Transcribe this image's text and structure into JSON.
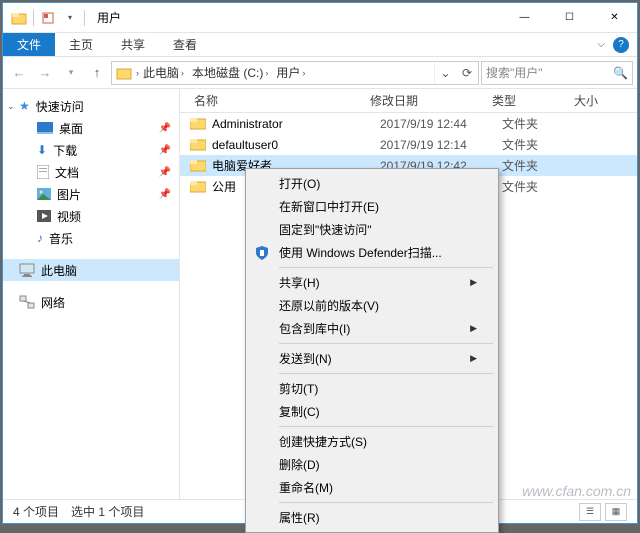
{
  "titlebar": {
    "title": "用户"
  },
  "winbtns": {
    "min": "—",
    "max": "☐",
    "close": "✕"
  },
  "ribbon": {
    "file": "文件",
    "home": "主页",
    "share": "共享",
    "view": "查看"
  },
  "breadcrumb": {
    "items": [
      "此电脑",
      "本地磁盘 (C:)",
      "用户"
    ]
  },
  "search": {
    "placeholder": "搜索\"用户\""
  },
  "sidebar": {
    "quick_access": "快速访问",
    "desktop": "桌面",
    "downloads": "下载",
    "documents": "文档",
    "pictures": "图片",
    "videos": "视频",
    "music": "音乐",
    "this_pc": "此电脑",
    "network": "网络"
  },
  "columns": {
    "name": "名称",
    "date": "修改日期",
    "type": "类型",
    "size": "大小"
  },
  "files": [
    {
      "name": "Administrator",
      "date": "2017/9/19 12:44",
      "type": "文件夹"
    },
    {
      "name": "defaultuser0",
      "date": "2017/9/19 12:14",
      "type": "文件夹"
    },
    {
      "name": "电脑爱好者",
      "date": "2017/9/19 12:42",
      "type": "文件夹",
      "selected": true
    },
    {
      "name": "公用",
      "date": "",
      "type": "文件夹"
    }
  ],
  "context_menu": [
    {
      "label": "打开(O)"
    },
    {
      "label": "在新窗口中打开(E)"
    },
    {
      "label": "固定到\"快速访问\""
    },
    {
      "label": "使用 Windows Defender扫描...",
      "icon": "defender"
    },
    {
      "sep": true
    },
    {
      "label": "共享(H)",
      "sub": true
    },
    {
      "label": "还原以前的版本(V)"
    },
    {
      "label": "包含到库中(I)",
      "sub": true
    },
    {
      "sep": true
    },
    {
      "label": "发送到(N)",
      "sub": true
    },
    {
      "sep": true
    },
    {
      "label": "剪切(T)"
    },
    {
      "label": "复制(C)"
    },
    {
      "sep": true
    },
    {
      "label": "创建快捷方式(S)"
    },
    {
      "label": "删除(D)"
    },
    {
      "label": "重命名(M)"
    },
    {
      "sep": true
    },
    {
      "label": "属性(R)"
    }
  ],
  "status": {
    "count": "4 个项目",
    "sel": "选中 1 个项目"
  },
  "watermark": "www.cfan.com.cn"
}
